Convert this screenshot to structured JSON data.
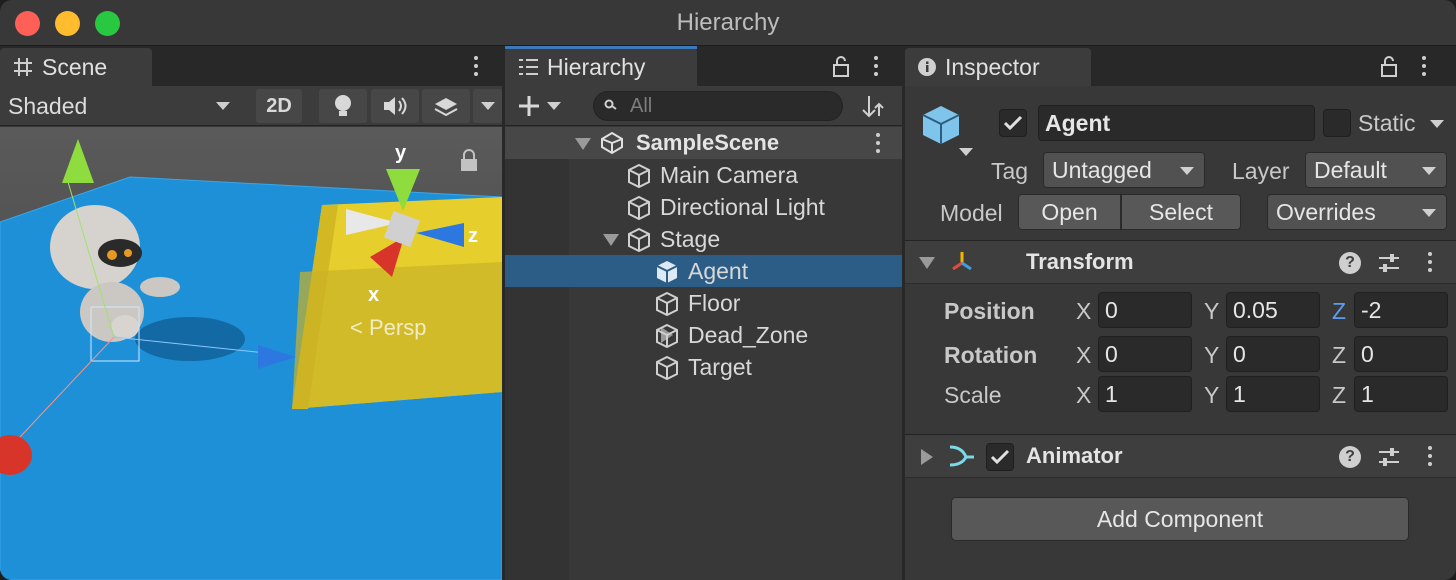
{
  "window": {
    "title": "Hierarchy"
  },
  "scene": {
    "tab_label": "Scene",
    "shading_mode": "Shaded",
    "mode_2d_label": "2D",
    "gizmo_labels": {
      "y": "y",
      "x": "x",
      "z": "z",
      "persp": "< Persp"
    }
  },
  "hierarchy": {
    "tab_label": "Hierarchy",
    "search_placeholder": "All",
    "scene_name": "SampleScene",
    "items": [
      {
        "label": "Main Camera",
        "depth": 1,
        "expander": "none",
        "selected": false
      },
      {
        "label": "Directional Light",
        "depth": 1,
        "expander": "none",
        "selected": false
      },
      {
        "label": "Stage",
        "depth": 1,
        "expander": "expanded",
        "selected": false
      },
      {
        "label": "Agent",
        "depth": 2,
        "expander": "collapsed",
        "selected": true
      },
      {
        "label": "Floor",
        "depth": 2,
        "expander": "none",
        "selected": false
      },
      {
        "label": "Dead_Zone",
        "depth": 2,
        "expander": "collapsed",
        "selected": false
      },
      {
        "label": "Target",
        "depth": 2,
        "expander": "none",
        "selected": false
      }
    ]
  },
  "inspector": {
    "tab_label": "Inspector",
    "object_name": "Agent",
    "active": true,
    "static_label": "Static",
    "static_checked": false,
    "tag_label": "Tag",
    "tag_value": "Untagged",
    "layer_label": "Layer",
    "layer_value": "Default",
    "model_label": "Model",
    "open_label": "Open",
    "select_label": "Select",
    "overrides_label": "Overrides",
    "transform": {
      "title": "Transform",
      "position_label": "Position",
      "rotation_label": "Rotation",
      "scale_label": "Scale",
      "axis_x": "X",
      "axis_y": "Y",
      "axis_z": "Z",
      "position": {
        "x": "0",
        "y": "0.05",
        "z": "-2"
      },
      "rotation": {
        "x": "0",
        "y": "0",
        "z": "0"
      },
      "scale": {
        "x": "1",
        "y": "1",
        "z": "1"
      }
    },
    "animator": {
      "title": "Animator",
      "enabled": true
    },
    "add_component_label": "Add Component"
  },
  "colors": {
    "selection": "#2c5d87",
    "accent_tab": "#3a79bb",
    "floor": "#1e90d8",
    "cube": "#e6cf2c"
  }
}
